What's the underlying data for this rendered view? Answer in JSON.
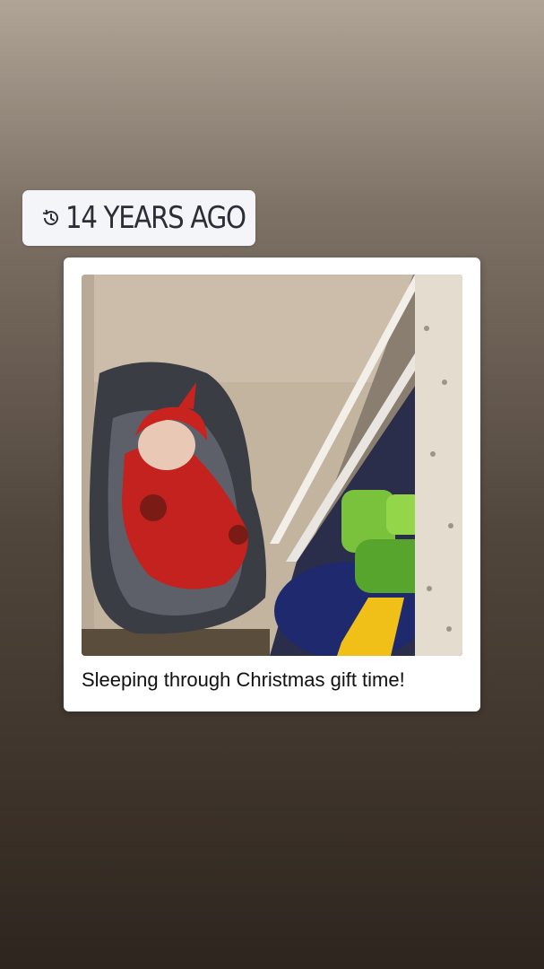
{
  "memory": {
    "label": "14 YEARS AGO",
    "icon": "history-icon"
  },
  "post": {
    "caption": "Sleeping through Christmas gift time!",
    "photo_subject": "photo"
  },
  "colors": {
    "badge_bg": "#f3f5f9",
    "badge_text": "#2b2e36",
    "card_bg": "#ffffff"
  }
}
